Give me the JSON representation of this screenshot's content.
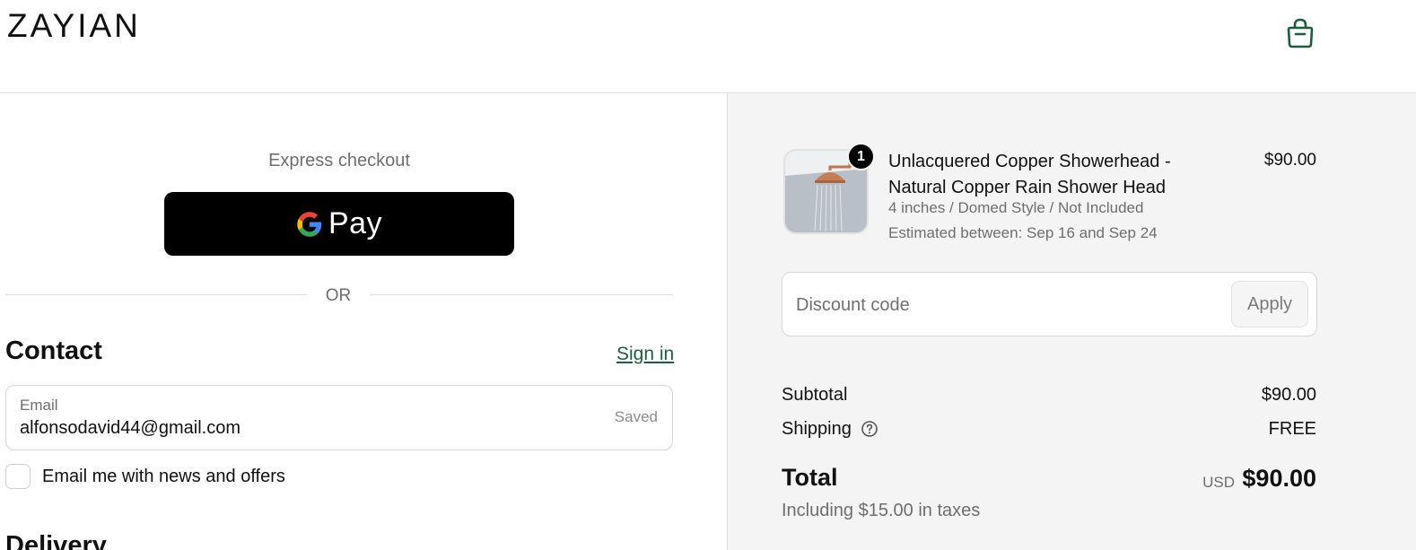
{
  "header": {
    "logo": "ZAYIAN",
    "cart_icon": "shopping-bag-icon",
    "accent_color": "#1b5e3b"
  },
  "express": {
    "label": "Express checkout",
    "gpay_label": "Pay",
    "divider_text": "OR"
  },
  "contact": {
    "heading": "Contact",
    "signin_label": "Sign in",
    "email_label": "Email",
    "email_value": "alfonsodavid44@gmail.com",
    "saved_label": "Saved",
    "newsletter_label": "Email me with news and offers",
    "newsletter_checked": false
  },
  "delivery": {
    "heading": "Delivery"
  },
  "order": {
    "item": {
      "quantity": "1",
      "title": "Unlacquered Copper Showerhead - Natural Copper Rain Shower Head",
      "variant": "4 inches / Domed Style / Not Included",
      "estimate": "Estimated between: Sep 16 and Sep 24",
      "price": "$90.00"
    },
    "discount": {
      "placeholder": "Discount code",
      "apply_label": "Apply"
    },
    "summary": {
      "subtotal_label": "Subtotal",
      "subtotal_value": "$90.00",
      "shipping_label": "Shipping",
      "shipping_value": "FREE",
      "total_label": "Total",
      "currency": "USD",
      "total_value": "$90.00",
      "tax_note": "Including $15.00 in taxes"
    }
  }
}
